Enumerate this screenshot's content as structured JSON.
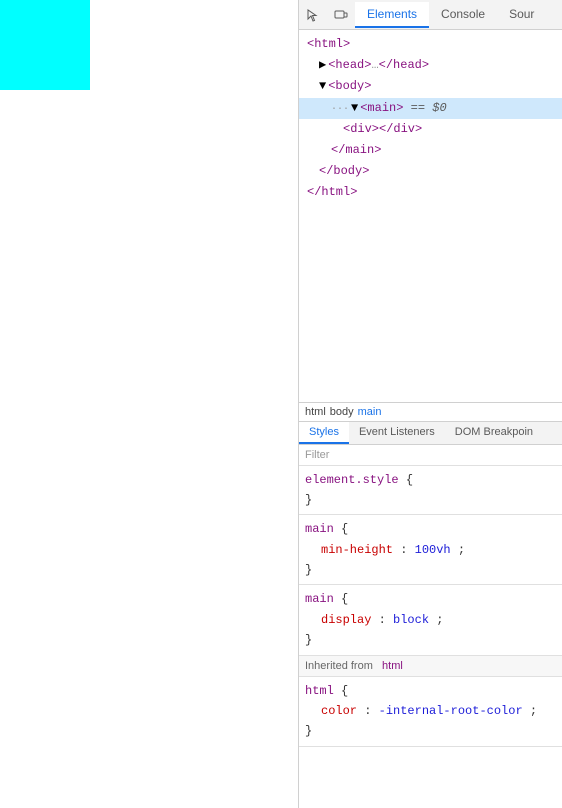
{
  "webpage": {
    "bg_color": "#ffffff",
    "cyan_box": "visible"
  },
  "devtools": {
    "toolbar": {
      "icon1": "cursor-icon",
      "icon2": "device-icon"
    },
    "tabs": [
      {
        "label": "Elements",
        "active": true
      },
      {
        "label": "Console",
        "active": false
      },
      {
        "label": "Sour",
        "active": false
      }
    ],
    "elements_tree": [
      {
        "indent": 1,
        "html": "<html>"
      },
      {
        "indent": 2,
        "html": "▶ <head>…</head>"
      },
      {
        "indent": 2,
        "html": "▼ <body>"
      },
      {
        "indent": 3,
        "html": "▼ <main> == $0",
        "selected": true
      },
      {
        "indent": 4,
        "html": "<div></div>"
      },
      {
        "indent": 3,
        "html": "</main>"
      },
      {
        "indent": 2,
        "html": "</body>"
      },
      {
        "indent": 1,
        "html": "</html>"
      }
    ],
    "breadcrumb": {
      "items": [
        {
          "label": "html",
          "active": false
        },
        {
          "label": "body",
          "active": false
        },
        {
          "label": "main",
          "active": true
        }
      ]
    },
    "sub_tabs": [
      {
        "label": "Styles",
        "active": true
      },
      {
        "label": "Event Listeners",
        "active": false
      },
      {
        "label": "DOM Breakpoin",
        "active": false
      }
    ],
    "filter_placeholder": "Filter",
    "style_rules": [
      {
        "selector": "element.style",
        "properties": []
      },
      {
        "selector": "main",
        "properties": [
          {
            "name": "min-height",
            "value": "100vh"
          }
        ]
      },
      {
        "selector": "main",
        "properties": [
          {
            "name": "display",
            "value": "block"
          }
        ]
      }
    ],
    "inherited_from": {
      "label": "Inherited from",
      "tag": "html",
      "rules": [
        {
          "selector": "html",
          "properties": [
            {
              "name": "color",
              "value": "-internal-root-color"
            }
          ]
        }
      ]
    }
  }
}
